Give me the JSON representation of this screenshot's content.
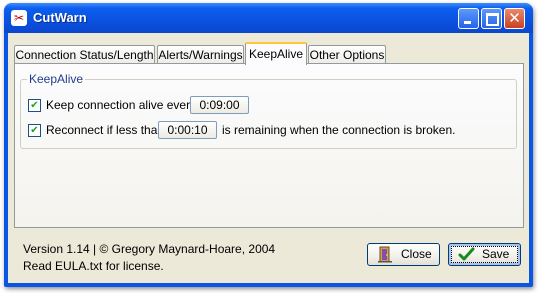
{
  "window": {
    "title": "CutWarn",
    "app_icon": "cutwarn-app-icon"
  },
  "titlebar_buttons": {
    "minimize": "minimize-icon",
    "maximize": "maximize-icon",
    "close": "close-icon",
    "close_glyph": "✕"
  },
  "tabs": [
    {
      "label": "Connection Status/Length",
      "active": false
    },
    {
      "label": "Alerts/Warnings",
      "active": false
    },
    {
      "label": "KeepAlive",
      "active": true
    },
    {
      "label": "Other Options",
      "active": false
    }
  ],
  "keepalive": {
    "group_title": "KeepAlive",
    "keep_alive": {
      "checked": true,
      "label": "Keep connection alive every",
      "value": "0:09:00"
    },
    "reconnect": {
      "checked": true,
      "label": "Reconnect if less than",
      "value": "0:00:10",
      "suffix": "is remaining when the connection is broken."
    }
  },
  "footer": {
    "version": "Version 1.14 | © Gregory Maynard-Hoare, 2004",
    "license": "Read EULA.txt for license."
  },
  "buttons": {
    "close_label": "Close",
    "save_label": "Save"
  },
  "colors": {
    "titlebar": "#0a53e0",
    "dialog_bg": "#ece9d8",
    "group_title": "#1f3c96",
    "active_tab_accent": "#ffc83c",
    "check": "#21a121"
  }
}
